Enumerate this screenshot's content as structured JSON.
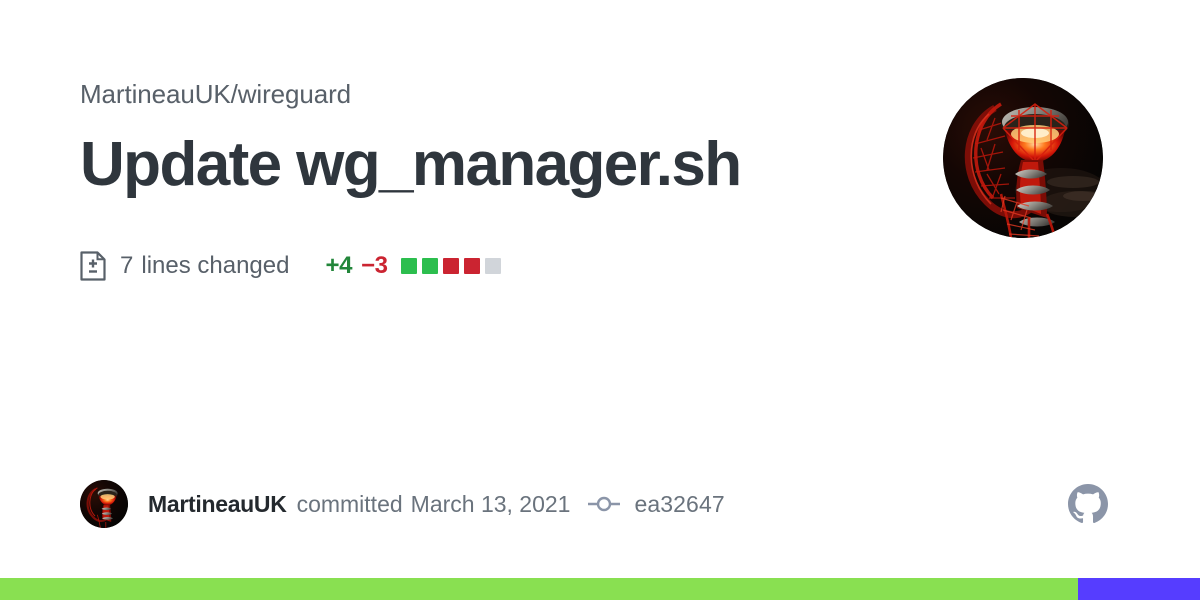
{
  "card": {
    "background_color": "#ffffff"
  },
  "header": {
    "repo_full_name": "MartineauUK/wireguard",
    "commit_title": "Update wg_manager.sh"
  },
  "diffstat": {
    "file_diff_icon": "file-diff-icon",
    "lines_count": "7",
    "lines_label": "lines changed",
    "additions": "+4",
    "deletions": "−3",
    "addition_color": "#22863a",
    "deletion_color": "#cb2431",
    "blocks": [
      {
        "name": "diff-block-addition",
        "color": "#2cbe4e"
      },
      {
        "name": "diff-block-addition",
        "color": "#2cbe4e"
      },
      {
        "name": "diff-block-deletion",
        "color": "#cb2431"
      },
      {
        "name": "diff-block-deletion",
        "color": "#cb2431"
      },
      {
        "name": "diff-block-neutral",
        "color": "#d1d5da"
      }
    ]
  },
  "avatar": {
    "name": "owner-avatar",
    "alt": "MartineauUK avatar",
    "description": "ArcelorMittal Orbit tower lit red at night"
  },
  "footer": {
    "author_name": "MartineauUK",
    "verb": "committed",
    "date": "March 13, 2021",
    "commit_icon": "git-commit-icon",
    "commit_sha": "ea32647",
    "github_logo": "github-mark-icon",
    "github_logo_color": "#8b95a8",
    "icon_color": "#8b95a8"
  },
  "language_bar": {
    "segments": [
      {
        "name": "language-segment-shell",
        "color": "#89e051",
        "percent": 89.8
      },
      {
        "name": "language-segment-other",
        "color": "#563dff",
        "percent": 10.2
      }
    ]
  }
}
